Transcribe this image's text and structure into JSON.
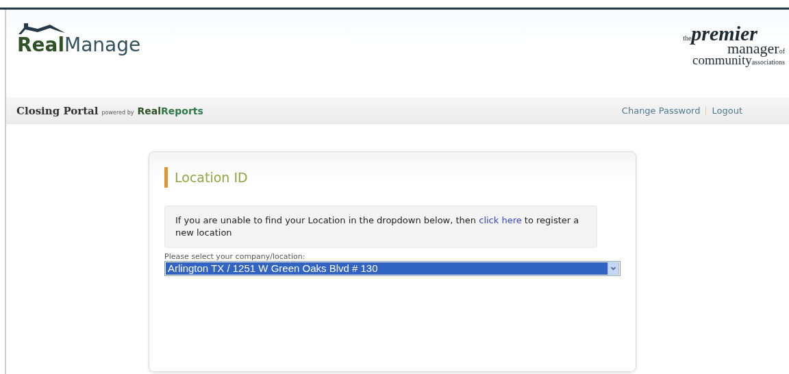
{
  "header": {
    "logo": {
      "bold": "Real",
      "rest": "Manage"
    },
    "tagline": {
      "the": "the",
      "premier": "premier",
      "manager": "manager",
      "of": "of",
      "community": "community",
      "associations": "associations"
    }
  },
  "nav": {
    "title": "Closing Portal",
    "powered": "powered by",
    "brand_bold": "Real",
    "brand_rest": "Reports",
    "links": [
      "Change Password",
      "Logout"
    ]
  },
  "card": {
    "heading": "Location ID",
    "notice": {
      "before": "If you are unable to find your Location in the dropdown below, then",
      "link": "click here",
      "after": "to register a new location"
    },
    "select": {
      "label": "Please select your company/location:",
      "value": "Arlington TX / 1251 W Green Oaks Blvd # 130",
      "focused": true
    }
  }
}
